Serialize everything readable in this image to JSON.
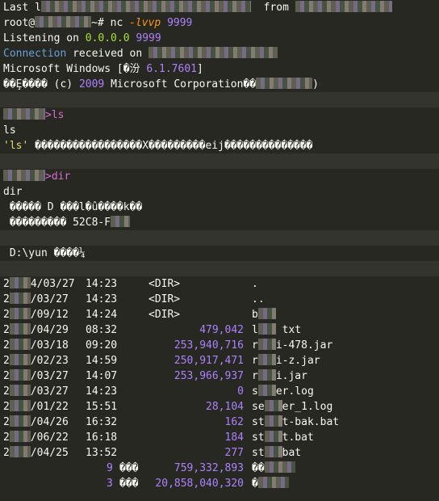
{
  "lines": {
    "last_login_prefix": "Last l",
    "last_login_from": "from",
    "prompt_prefix": "root@",
    "prompt_suffix": "~# ",
    "nc_cmd": "nc ",
    "nc_flags": "-lvvp",
    "nc_port": " 9999",
    "listening_text": "Listening on ",
    "listening_addr": "0.0.0.0",
    "listening_port": " 9999",
    "connection_word": "Connection",
    "received_on": " received on",
    "win_prefix": "Microsoft Windows [",
    "win_garbled": "�汾",
    "win_version": " 6.1.7601",
    "win_close": "]",
    "copyright_garbled_a": "��Ȩ����",
    "copyright_c": " (c) ",
    "copyright_year": "2009",
    "copyright_corp": " Microsoft Corporation��",
    "copyright_close": ")",
    "prompt_ls_arrow": ">",
    "cmd_ls": "ls",
    "ls_echo": "ls",
    "ls_error_quote": "'ls'",
    "ls_error_text": " �����������������X���������eij��������������",
    "prompt_dir_arrow": ">",
    "cmd_dir": "dir",
    "dir_echo": "dir",
    "vol_line_a": " ����� D ���l�û����k��",
    "vol_line_b": " ��������� ",
    "vol_serial": "52C8-F",
    "dir_of": " D:\\yun ����¼"
  },
  "listing": [
    {
      "date_prefix": "2",
      "date_suffix": "4/03/27",
      "time": "14:23",
      "dir": "<DIR>",
      "size": "",
      "name_a": ".",
      "name_b": ""
    },
    {
      "date_prefix": "2",
      "date_suffix": "/03/27",
      "time": "14:23",
      "dir": "<DIR>",
      "size": "",
      "name_a": "..",
      "name_b": ""
    },
    {
      "date_prefix": "2",
      "date_suffix": "/09/12",
      "time": "14:24",
      "dir": "<DIR>",
      "size": "",
      "name_a": "b",
      "name_b": ""
    },
    {
      "date_prefix": "2",
      "date_suffix": "/04/29",
      "time": "08:32",
      "dir": "",
      "size": "479,042",
      "name_a": "l",
      "name_b": " txt"
    },
    {
      "date_prefix": "2",
      "date_suffix": "/03/18",
      "time": "09:20",
      "dir": "",
      "size": "253,940,716",
      "name_a": "r",
      "name_b": "i-478.jar"
    },
    {
      "date_prefix": "2",
      "date_suffix": "/02/23",
      "time": "14:59",
      "dir": "",
      "size": "250,917,471",
      "name_a": "r",
      "name_b": "i-z.jar"
    },
    {
      "date_prefix": "2",
      "date_suffix": "/03/27",
      "time": "14:07",
      "dir": "",
      "size": "253,966,937",
      "name_a": "r",
      "name_b": "i.jar"
    },
    {
      "date_prefix": "2",
      "date_suffix": "/03/27",
      "time": "14:23",
      "dir": "",
      "size": "0",
      "name_a": "s",
      "name_b": "er.log"
    },
    {
      "date_prefix": "2",
      "date_suffix": "/01/22",
      "time": "15:51",
      "dir": "",
      "size": "28,104",
      "name_a": "se",
      "name_b": "er_1.log"
    },
    {
      "date_prefix": "2",
      "date_suffix": "/04/26",
      "time": "16:32",
      "dir": "",
      "size": "162",
      "name_a": "st",
      "name_b": "t-bak.bat"
    },
    {
      "date_prefix": "2",
      "date_suffix": "/06/22",
      "time": "16:18",
      "dir": "",
      "size": "184",
      "name_a": "st",
      "name_b": "t.bat"
    },
    {
      "date_prefix": "2",
      "date_suffix": "/04/25",
      "time": "13:52",
      "dir": "",
      "size": "277",
      "name_a": "st",
      "name_b": "bat"
    }
  ],
  "summary": [
    {
      "count": "9",
      "label": "���",
      "size": "759,332,893",
      "tail": "��"
    },
    {
      "count": "3",
      "label": "���",
      "size": "20,858,040,320",
      "tail": "�"
    }
  ]
}
